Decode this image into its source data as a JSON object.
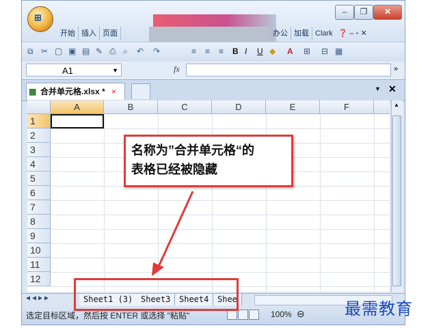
{
  "ribbon": {
    "tabs_left": [
      "开始",
      "插入",
      "页面"
    ],
    "tabs_right": [
      "办公",
      "加载",
      "Clark"
    ],
    "help_icon": "help-icon"
  },
  "formula_bar": {
    "name_box": "A1",
    "fx_label": "fx",
    "formula_value": ""
  },
  "document_tab": {
    "label": "合并单元格.xlsx *",
    "close": "×"
  },
  "grid": {
    "columns": [
      "A",
      "B",
      "C",
      "D",
      "E",
      "F"
    ],
    "rows": [
      "1",
      "2",
      "3",
      "4",
      "5",
      "6",
      "7",
      "8",
      "9",
      "10",
      "11",
      "12"
    ],
    "active_cell": "A1"
  },
  "sheet_tabs": [
    "Sheet1 (3)",
    "Sheet3",
    "Sheet4",
    "Shee"
  ],
  "status": {
    "text": "选定目标区域，然后按 ENTER 或选择 \"粘贴\"",
    "zoom": "100%"
  },
  "annotation": {
    "line1": "名称为”合并单元格“的",
    "line2": "表格已经被隐藏"
  },
  "watermark": "最需教育",
  "colors": {
    "accent_red": "#e03a3a",
    "ribbon_blue": "#dbe6f4",
    "watermark_blue": "#1a49c0"
  }
}
